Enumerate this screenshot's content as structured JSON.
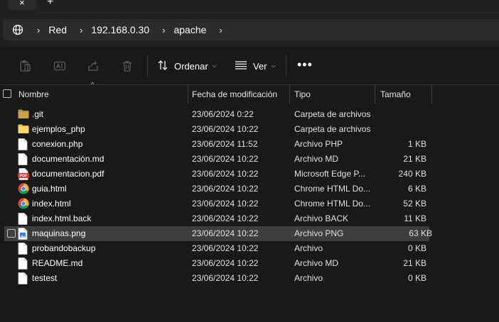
{
  "tabbar": {
    "close_glyph": "×",
    "new_tab_glyph": "+"
  },
  "address": {
    "icon": "globe-icon",
    "crumbs": [
      "Red",
      "192.168.0.30",
      "apache"
    ],
    "separator": "›"
  },
  "toolbar": {
    "icons": [
      "clipboard-icon",
      "rename-icon",
      "share-icon",
      "trash-icon"
    ],
    "sort_label": "Ordenar",
    "view_label": "Ver",
    "more_label": "•••"
  },
  "columns": {
    "name": "Nombre",
    "date": "Fecha de modificación",
    "type": "Tipo",
    "size": "Tamaño"
  },
  "files": [
    {
      "name": ".git",
      "date": "23/06/2024 0:22",
      "type": "Carpeta de archivos",
      "size": "",
      "icon": "folder-dark-icon"
    },
    {
      "name": "ejemplos_php",
      "date": "23/06/2024 10:22",
      "type": "Carpeta de archivos",
      "size": "",
      "icon": "folder-icon"
    },
    {
      "name": "conexion.php",
      "date": "23/06/2024 11:52",
      "type": "Archivo PHP",
      "size": "1 KB",
      "icon": "file-icon"
    },
    {
      "name": "documentación.md",
      "date": "23/06/2024 10:22",
      "type": "Archivo MD",
      "size": "21 KB",
      "icon": "file-icon"
    },
    {
      "name": "documentacion.pdf",
      "date": "23/06/2024 10:22",
      "type": "Microsoft Edge P...",
      "size": "240 KB",
      "icon": "pdf-icon"
    },
    {
      "name": "guia.html",
      "date": "23/06/2024 10:22",
      "type": "Chrome HTML Do...",
      "size": "6 KB",
      "icon": "chrome-icon"
    },
    {
      "name": "index.html",
      "date": "23/06/2024 10:22",
      "type": "Chrome HTML Do...",
      "size": "52 KB",
      "icon": "chrome-icon"
    },
    {
      "name": "index.html.back",
      "date": "23/06/2024 10:22",
      "type": "Archivo BACK",
      "size": "11 KB",
      "icon": "file-icon"
    },
    {
      "name": "maquinas.png",
      "date": "23/06/2024 10:22",
      "type": "Archivo PNG",
      "size": "63 KB",
      "icon": "image-file-icon",
      "selected": true
    },
    {
      "name": "probandobackup",
      "date": "23/06/2024 10:22",
      "type": "Archivo",
      "size": "0 KB",
      "icon": "file-icon"
    },
    {
      "name": "README.md",
      "date": "23/06/2024 10:22",
      "type": "Archivo MD",
      "size": "21 KB",
      "icon": "file-icon"
    },
    {
      "name": "testest",
      "date": "23/06/2024 10:22",
      "type": "Archivo",
      "size": "0 KB",
      "icon": "file-icon"
    }
  ],
  "colors": {
    "background": "#191919",
    "selected_row": "#3e3e3e",
    "folder": "#f2c14e",
    "pdf": "#d13438"
  }
}
